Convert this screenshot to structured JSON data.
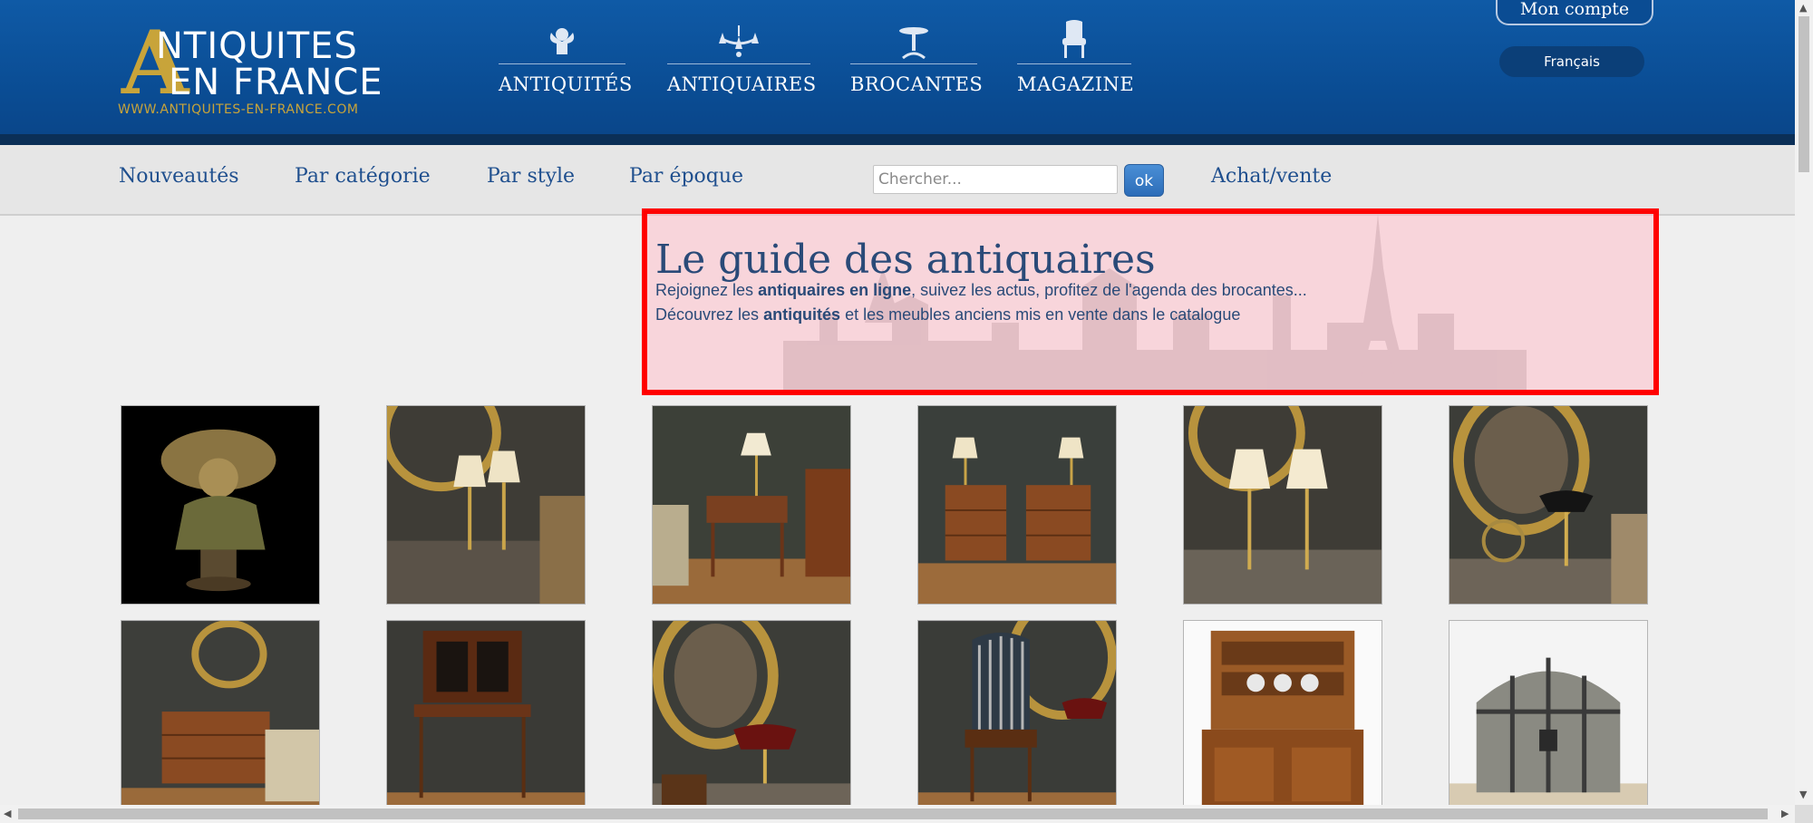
{
  "header": {
    "logo": {
      "line1": "NTIQUITES",
      "line2": "EN FRANCE",
      "url": "WWW.ANTIQUITES-EN-FRANCE.COM",
      "mark": "A"
    },
    "nav": [
      {
        "label": "ANTIQUITÉS",
        "icon": "cherub-icon"
      },
      {
        "label": "ANTIQUAIRES",
        "icon": "chandelier-icon"
      },
      {
        "label": "BROCANTES",
        "icon": "gueridon-table-icon"
      },
      {
        "label": "MAGAZINE",
        "icon": "armchair-icon"
      }
    ],
    "account_label": "Mon compte",
    "language_label": "Français"
  },
  "subnav": {
    "links": [
      "Nouveautés",
      "Par catégorie",
      "Par style",
      "Par époque"
    ],
    "search_placeholder": "Chercher...",
    "search_button": "ok",
    "extra_link": "Achat/vente"
  },
  "hero": {
    "title": "Le guide des antiquaires",
    "line1_pre": "Rejoignez les ",
    "line1_bold": "antiquaires en ligne",
    "line1_post": ", suivez les actus, profitez de l'agenda des brocantes...",
    "line2_pre": "Découvrez les ",
    "line2_bold": "antiquités",
    "line2_post": " et les meubles anciens mis en vente dans le catalogue"
  },
  "colors": {
    "header_blue": "#0a4c93",
    "logo_gold": "#c8a43a",
    "link_blue": "#1f4f8e",
    "hero_border": "#ff0000"
  }
}
